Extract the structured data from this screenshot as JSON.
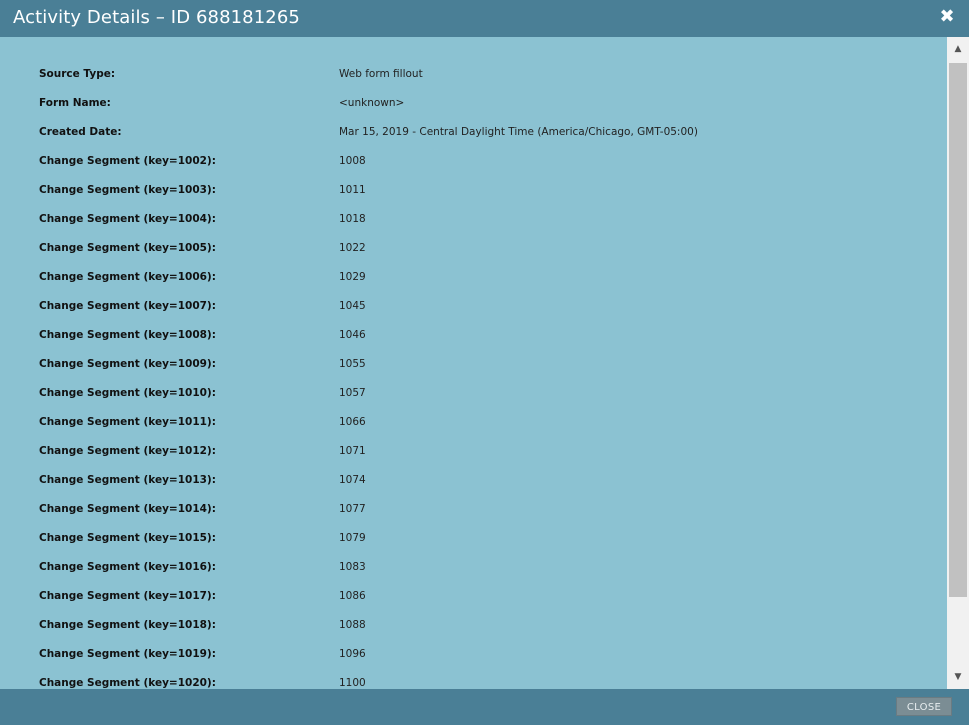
{
  "dialog": {
    "title": "Activity Details – ID 688181265",
    "close_icon": "close-icon",
    "close_button_label": "CLOSE"
  },
  "details": [
    {
      "label": "Source Type:",
      "value": "Web form fillout"
    },
    {
      "label": "Form Name:",
      "value": "<unknown>"
    },
    {
      "label": "Created Date:",
      "value": "Mar 15, 2019 - Central Daylight Time (America/Chicago, GMT-05:00)"
    },
    {
      "label": "Change Segment (key=1002):",
      "value": "1008"
    },
    {
      "label": "Change Segment (key=1003):",
      "value": "1011"
    },
    {
      "label": "Change Segment (key=1004):",
      "value": "1018"
    },
    {
      "label": "Change Segment (key=1005):",
      "value": "1022"
    },
    {
      "label": "Change Segment (key=1006):",
      "value": "1029"
    },
    {
      "label": "Change Segment (key=1007):",
      "value": "1045"
    },
    {
      "label": "Change Segment (key=1008):",
      "value": "1046"
    },
    {
      "label": "Change Segment (key=1009):",
      "value": "1055"
    },
    {
      "label": "Change Segment (key=1010):",
      "value": "1057"
    },
    {
      "label": "Change Segment (key=1011):",
      "value": "1066"
    },
    {
      "label": "Change Segment (key=1012):",
      "value": "1071"
    },
    {
      "label": "Change Segment (key=1013):",
      "value": "1074"
    },
    {
      "label": "Change Segment (key=1014):",
      "value": "1077"
    },
    {
      "label": "Change Segment (key=1015):",
      "value": "1079"
    },
    {
      "label": "Change Segment (key=1016):",
      "value": "1083"
    },
    {
      "label": "Change Segment (key=1017):",
      "value": "1086"
    },
    {
      "label": "Change Segment (key=1018):",
      "value": "1088"
    },
    {
      "label": "Change Segment (key=1019):",
      "value": "1096"
    },
    {
      "label": "Change Segment (key=1020):",
      "value": "1100"
    }
  ],
  "colors": {
    "header_bg": "#4a7f96",
    "content_bg": "#8bc2d2"
  }
}
